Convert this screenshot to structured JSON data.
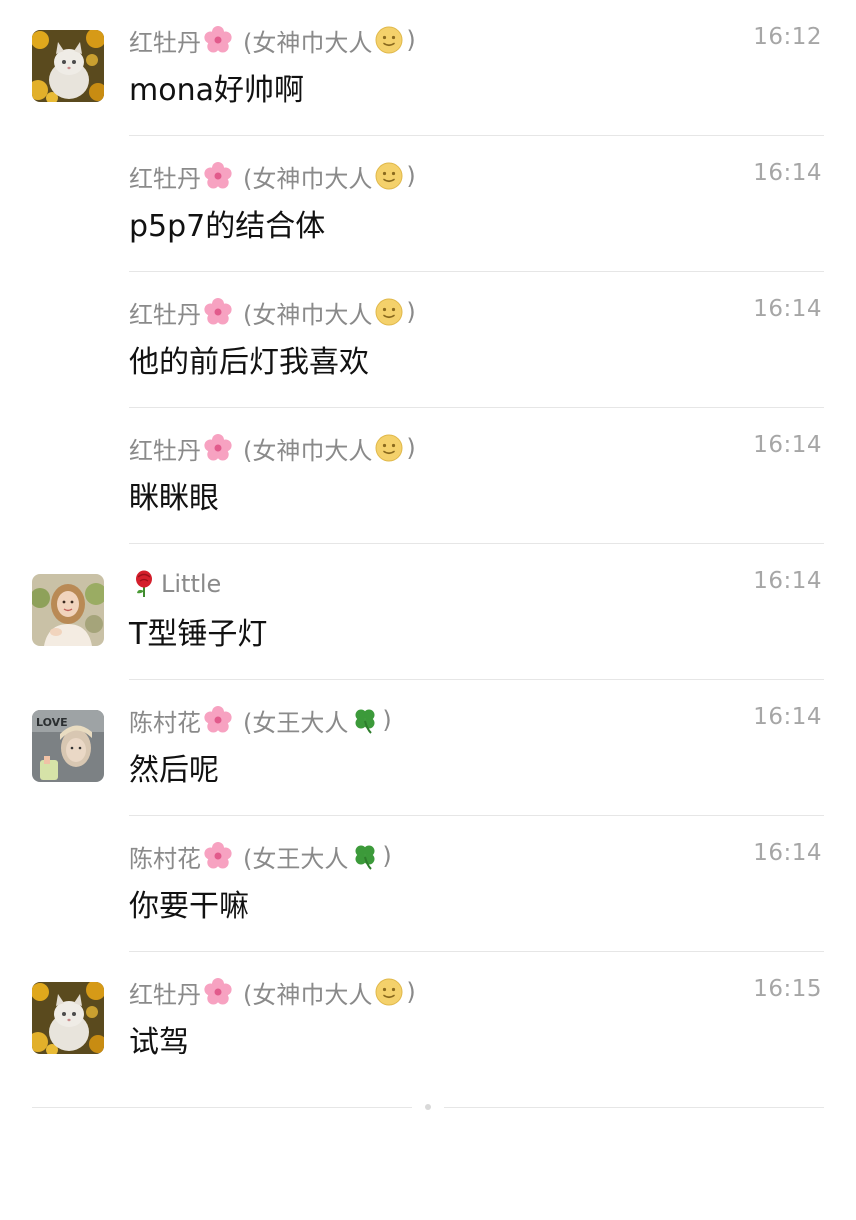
{
  "messages": [
    {
      "sender": "红牡丹",
      "title": "(女神巾大人",
      "title_close": ")",
      "time": "16:12",
      "text": "mona好帅啊",
      "avatar": "cat-avatar",
      "name_emoji": "blossom",
      "title_emoji": "smile-face"
    },
    {
      "sender": "红牡丹",
      "title": "(女神巾大人",
      "title_close": ")",
      "time": "16:14",
      "text": "p5p7的结合体",
      "name_emoji": "blossom",
      "title_emoji": "smile-face"
    },
    {
      "sender": "红牡丹",
      "title": "(女神巾大人",
      "title_close": ")",
      "time": "16:14",
      "text": "他的前后灯我喜欢",
      "name_emoji": "blossom",
      "title_emoji": "smile-face"
    },
    {
      "sender": "红牡丹",
      "title": "(女神巾大人",
      "title_close": ")",
      "time": "16:14",
      "text": "眯眯眼",
      "name_emoji": "blossom",
      "title_emoji": "smile-face"
    },
    {
      "sender": "Little",
      "time": "16:14",
      "text": "T型锤子灯",
      "avatar": "girl-avatar",
      "name_emoji": "rose"
    },
    {
      "sender": "陈村花",
      "title": "(女王大人",
      "title_close": ")",
      "time": "16:14",
      "text": "然后呢",
      "avatar": "poster-avatar",
      "name_emoji": "blossom",
      "title_emoji": "clover"
    },
    {
      "sender": "陈村花",
      "title": "(女王大人",
      "title_close": ")",
      "time": "16:14",
      "text": "你要干嘛",
      "name_emoji": "blossom",
      "title_emoji": "clover"
    },
    {
      "sender": "红牡丹",
      "title": "(女神巾大人",
      "title_close": ")",
      "time": "16:15",
      "text": "试驾",
      "avatar": "cat-avatar",
      "name_emoji": "blossom",
      "title_emoji": "smile-face"
    }
  ],
  "colors": {
    "name": "#8a8a8a",
    "time": "#a6a6a6",
    "text": "#111111",
    "divider": "#e6e6e6"
  }
}
